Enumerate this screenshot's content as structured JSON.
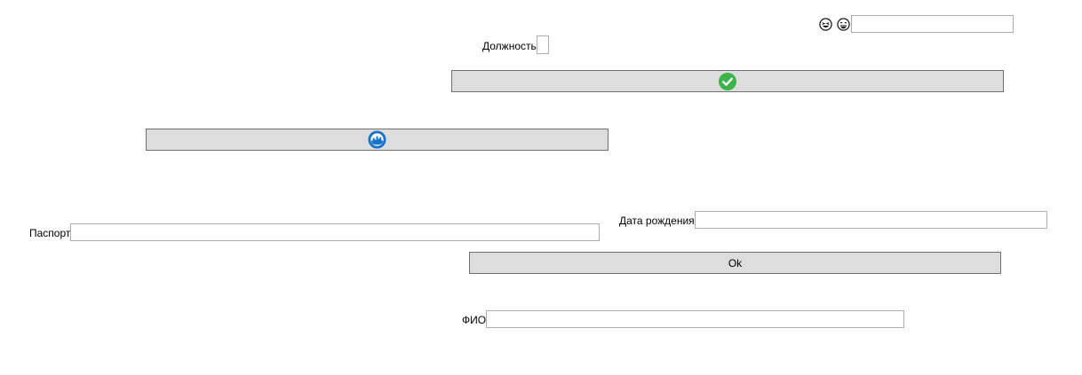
{
  "top_bar": {
    "icons": [
      "laughing-emoji-icon",
      "grinning-emoji-icon"
    ],
    "search_value": ""
  },
  "position_field": {
    "label": "Должность",
    "value": ""
  },
  "buttons": {
    "check_icon": "check-circle-icon",
    "brand_icon": "blue-circle-logo-icon",
    "ok_label": "Ok"
  },
  "birth_date_field": {
    "label": "Дата рождения",
    "value": ""
  },
  "passport_field": {
    "label": "Паспорт",
    "value": ""
  },
  "full_name_field": {
    "label": "ФИО",
    "value": ""
  },
  "colors": {
    "button_bg": "#dddddd",
    "button_border": "#707070",
    "input_border": "#adadad",
    "check_green": "#3bb54a",
    "logo_blue": "#1a73c9"
  }
}
